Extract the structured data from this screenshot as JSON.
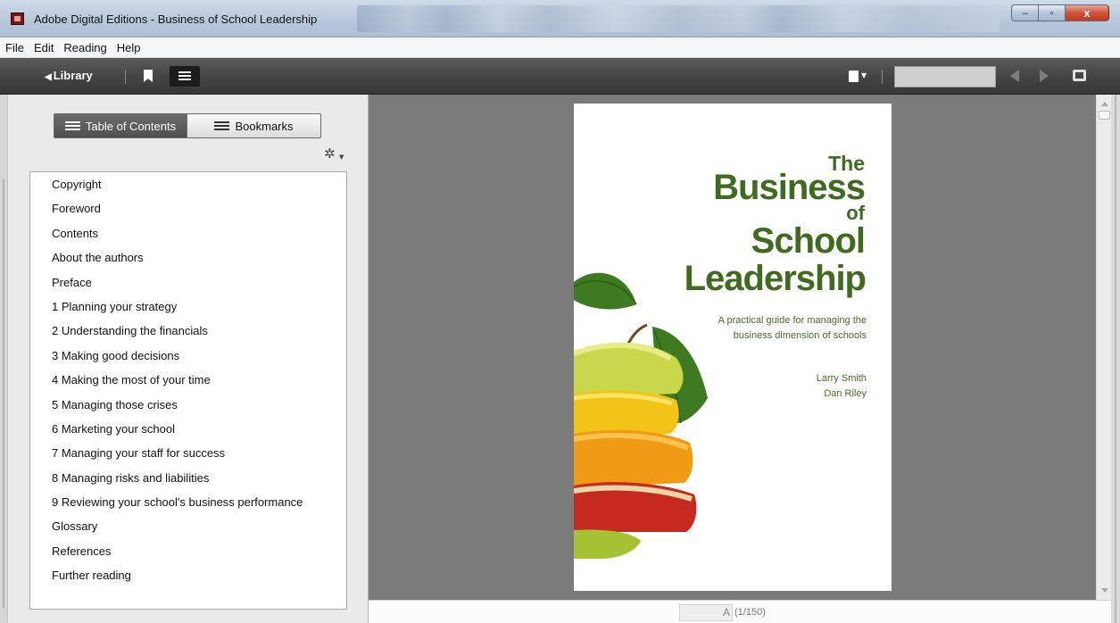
{
  "window": {
    "title": "Adobe Digital Editions - Business of School Leadership",
    "controls": [
      "minimize",
      "maximize",
      "close"
    ],
    "close_glyph": "x",
    "maximize_glyph": "▫",
    "minimize_glyph": "–"
  },
  "menu": [
    "File",
    "Edit",
    "Reading",
    "Help"
  ],
  "toolbar": {
    "library_label": "Library",
    "library_arrow": "◀",
    "search_value": ""
  },
  "sidebar": {
    "tabs": [
      {
        "label": "Table of Contents",
        "active": true
      },
      {
        "label": "Bookmarks",
        "active": false
      }
    ],
    "toc": [
      "Copyright",
      "Foreword",
      "Contents",
      "About the authors",
      "Preface",
      "1 Planning your strategy",
      "2 Understanding the financials",
      "3 Making good decisions",
      "4 Making the most of your time",
      "5 Managing those crises",
      "6 Marketing your school",
      "7 Managing your staff for success",
      "8 Managing risks and liabilities",
      "9 Reviewing your school's business performance",
      "Glossary",
      "References",
      "Further reading"
    ]
  },
  "cover": {
    "title_lines": [
      "The",
      "Business",
      "of",
      "School",
      "Leadership"
    ],
    "subtitle_lines": [
      "A practical guide for managing the",
      "business dimension of schools"
    ],
    "authors": [
      "Larry Smith",
      "Dan Riley"
    ],
    "title_color": "#3f6b1f"
  },
  "status": {
    "page_input_value": "A",
    "page_count": "(1/150)"
  },
  "colors": {
    "toolbar_bg": "#424242",
    "reader_bg": "#7b7b7b",
    "close_button": "#c2381f"
  }
}
